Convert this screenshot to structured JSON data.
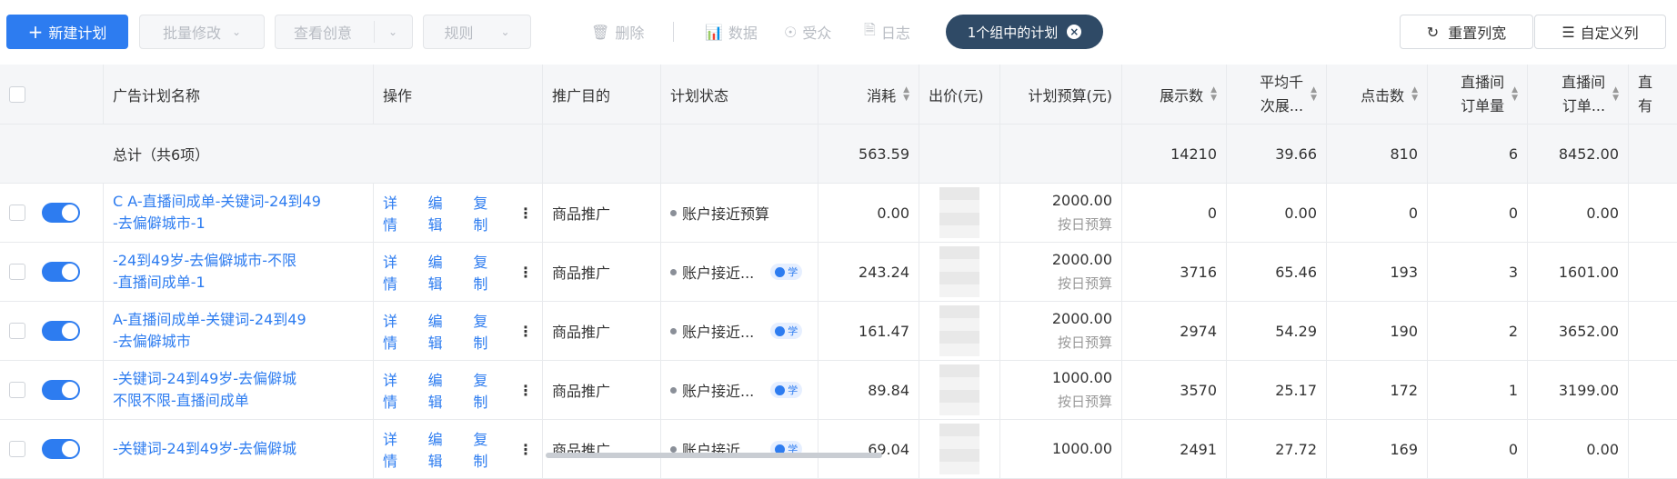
{
  "toolbar": {
    "new_plan": "新建计划",
    "batch_edit": "批量修改",
    "view_creative": "查看创意",
    "rules": "规则",
    "delete": "删除",
    "data": "数据",
    "audience": "受众",
    "log": "日志",
    "filter_chip": "1个组中的计划",
    "reset_width": "重置列宽",
    "custom_columns": "自定义列"
  },
  "table": {
    "headers": {
      "name": "广告计划名称",
      "ops": "操作",
      "goal": "推广目的",
      "status": "计划状态",
      "cost": "消耗",
      "bid": "出价(元)",
      "budget": "计划预算(元)",
      "impressions": "展示数",
      "cpm_1": "平均千",
      "cpm_2": "次展...",
      "clicks": "点击数",
      "orders_1": "直播间",
      "orders_2": "订单量",
      "order_amt_1": "直播间",
      "order_amt_2": "订单...",
      "extra_1": "直",
      "extra_2": "有"
    },
    "total": {
      "label": "总计（共6项）",
      "cost": "563.59",
      "impressions": "14210",
      "cpm": "39.66",
      "clicks": "810",
      "orders": "6",
      "order_amt": "8452.00"
    },
    "ops_labels": {
      "detail": "详情",
      "edit": "编辑",
      "copy": "复制",
      "more": "⋮"
    },
    "learn_label": "学",
    "rows": [
      {
        "name_1": "C  A-直播间成单-关键词-24到49",
        "name_2": "   -去偏僻城市-1",
        "goal": "商品推广",
        "status": "账户接近预算",
        "learn": false,
        "cost": "0.00",
        "budget": "2000.00",
        "budget_type": "按日预算",
        "impressions": "0",
        "cpm": "0.00",
        "clicks": "0",
        "orders": "0",
        "order_amt": "0.00"
      },
      {
        "name_1": "   -24到49岁-去偏僻城市-不限",
        "name_2": "   -直播间成单-1",
        "goal": "商品推广",
        "status": "账户接近...",
        "learn": true,
        "cost": "243.24",
        "budget": "2000.00",
        "budget_type": "按日预算",
        "impressions": "3716",
        "cpm": "65.46",
        "clicks": "193",
        "orders": "3",
        "order_amt": "1601.00"
      },
      {
        "name_1": "    A-直播间成单-关键词-24到49",
        "name_2": "   -去偏僻城市",
        "goal": "商品推广",
        "status": "账户接近...",
        "learn": true,
        "cost": "161.47",
        "budget": "2000.00",
        "budget_type": "按日预算",
        "impressions": "2974",
        "cpm": "54.29",
        "clicks": "190",
        "orders": "2",
        "order_amt": "3652.00"
      },
      {
        "name_1": "   -关键词-24到49岁-去偏僻城",
        "name_2": "   不限不限-直播间成单",
        "goal": "商品推广",
        "status": "账户接近...",
        "learn": true,
        "cost": "89.84",
        "budget": "1000.00",
        "budget_type": "按日预算",
        "impressions": "3570",
        "cpm": "25.17",
        "clicks": "172",
        "orders": "1",
        "order_amt": "3199.00"
      },
      {
        "name_1": "   -关键词-24到49岁-去偏僻城",
        "name_2": "",
        "goal": "商品推广",
        "status": "账户接近...",
        "learn": true,
        "cost": "69.04",
        "budget": "1000.00",
        "budget_type": "",
        "impressions": "2491",
        "cpm": "27.72",
        "clicks": "169",
        "orders": "0",
        "order_amt": "0.00"
      }
    ]
  }
}
